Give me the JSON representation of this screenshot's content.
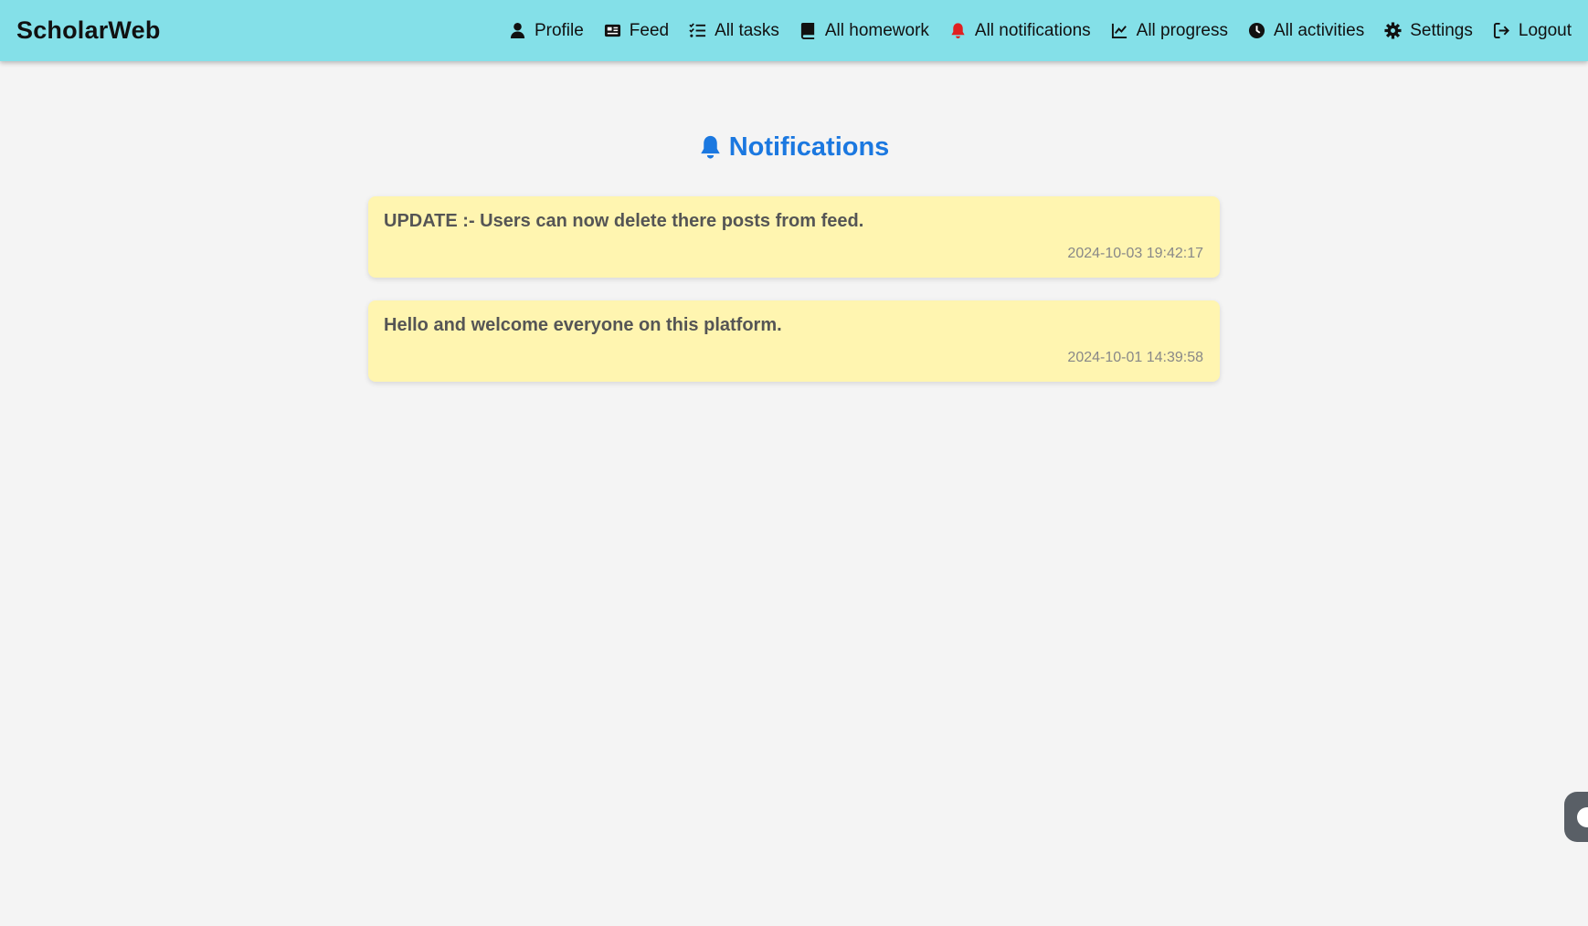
{
  "brand": "ScholarWeb",
  "nav": [
    {
      "label": "Profile",
      "icon": "user-icon"
    },
    {
      "label": "Feed",
      "icon": "newspaper-icon"
    },
    {
      "label": "All tasks",
      "icon": "list-check-icon"
    },
    {
      "label": "All homework",
      "icon": "book-icon"
    },
    {
      "label": "All notifications",
      "icon": "bell-icon",
      "active_color": "#e02020"
    },
    {
      "label": "All progress",
      "icon": "line-chart-icon"
    },
    {
      "label": "All activities",
      "icon": "clock-icon"
    },
    {
      "label": "Settings",
      "icon": "gear-icon"
    },
    {
      "label": "Logout",
      "icon": "logout-icon"
    }
  ],
  "page": {
    "title": "Notifications",
    "title_icon": "bell-icon",
    "accent": "#1b78e0"
  },
  "notifications": [
    {
      "message": "UPDATE :- Users can now delete there posts from feed.",
      "timestamp": "2024-10-03 19:42:17"
    },
    {
      "message": "Hello and welcome everyone on this platform.",
      "timestamp": "2024-10-01 14:39:58"
    }
  ],
  "colors": {
    "topbar": "#84e0e8",
    "card": "#fff5b0",
    "background": "#f4f4f4"
  }
}
